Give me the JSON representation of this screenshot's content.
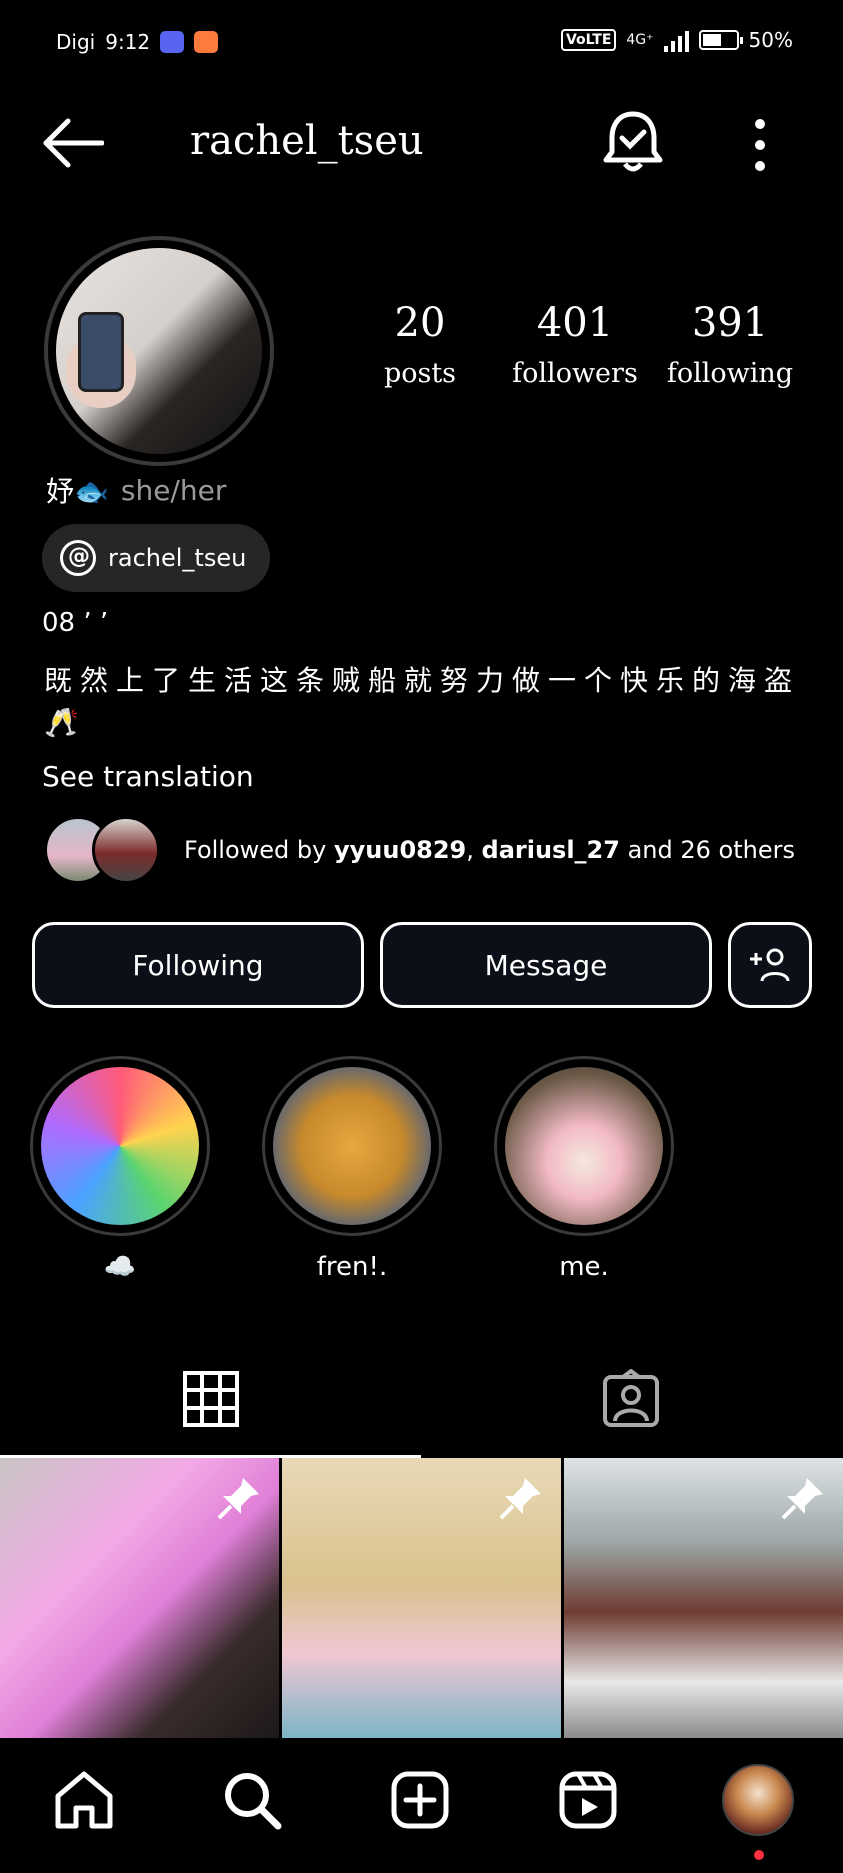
{
  "status_bar": {
    "carrier": "Digi",
    "time": "9:12",
    "network": "VoLTE",
    "signal": "4G⁺",
    "battery": "50%",
    "battery_level": 0.5
  },
  "header": {
    "username": "rachel_tseu"
  },
  "profile": {
    "stats": [
      {
        "value": "20",
        "label": "posts"
      },
      {
        "value": "401",
        "label": "followers"
      },
      {
        "value": "391",
        "label": "following"
      }
    ],
    "name": "妤🐟",
    "pronouns": "she/her",
    "threads_handle": "rachel_tseu",
    "bio_line1": "08 ’ ’",
    "bio_line2": "既然上了生活这条贼船就努力做一个快乐的海盗🥂",
    "see_translation": "See translation",
    "followed_by_prefix": "Followed by ",
    "followed_by_user1": "yyuu0829",
    "followed_by_sep": ", ",
    "followed_by_user2": "dariusl_27",
    "followed_by_suffix": " and 26 others"
  },
  "actions": {
    "following_label": "Following",
    "message_label": "Message"
  },
  "highlights": [
    {
      "label": "☁️"
    },
    {
      "label": "fren!."
    },
    {
      "label": "me."
    }
  ],
  "icons": {
    "back": "back-arrow-icon",
    "bell": "notification-bell-icon",
    "more": "more-options-icon",
    "grid": "grid-icon",
    "tagged": "tagged-icon",
    "pin": "pin-icon"
  }
}
